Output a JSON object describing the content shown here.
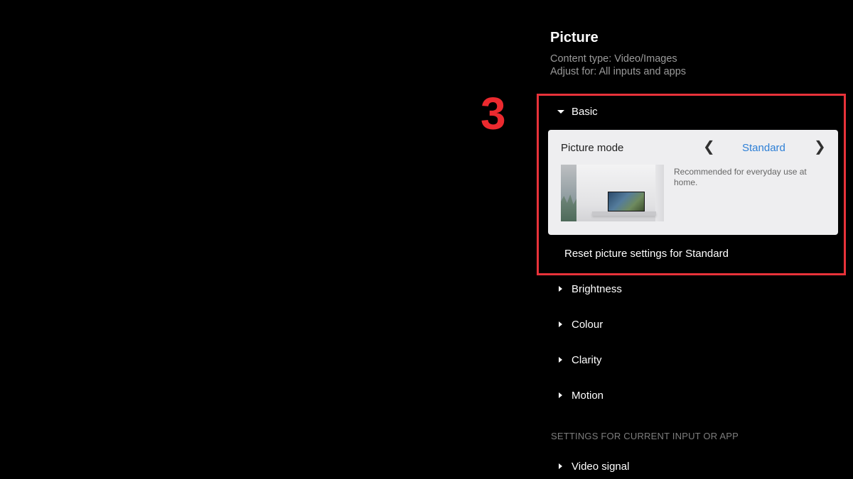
{
  "panel": {
    "title": "Picture",
    "content_type": "Content type: Video/Images",
    "adjust_for": "Adjust for: All inputs and apps"
  },
  "annotation": {
    "number": "3",
    "color": "#e8323a"
  },
  "basic": {
    "label": "Basic",
    "expanded": true,
    "picture_mode": {
      "label": "Picture mode",
      "value": "Standard",
      "description": "Recommended for everyday use at home."
    },
    "reset_label": "Reset picture settings for Standard"
  },
  "menu_items": [
    {
      "label": "Brightness"
    },
    {
      "label": "Colour"
    },
    {
      "label": "Clarity"
    },
    {
      "label": "Motion"
    }
  ],
  "section": {
    "header": "SETTINGS FOR CURRENT INPUT OR APP",
    "items": [
      {
        "label": "Video signal"
      }
    ]
  },
  "colors": {
    "background": "#000000",
    "accent_blue": "#2d7fd6",
    "card_bg": "#eeeef0",
    "secondary_text": "#9a9a9a"
  }
}
